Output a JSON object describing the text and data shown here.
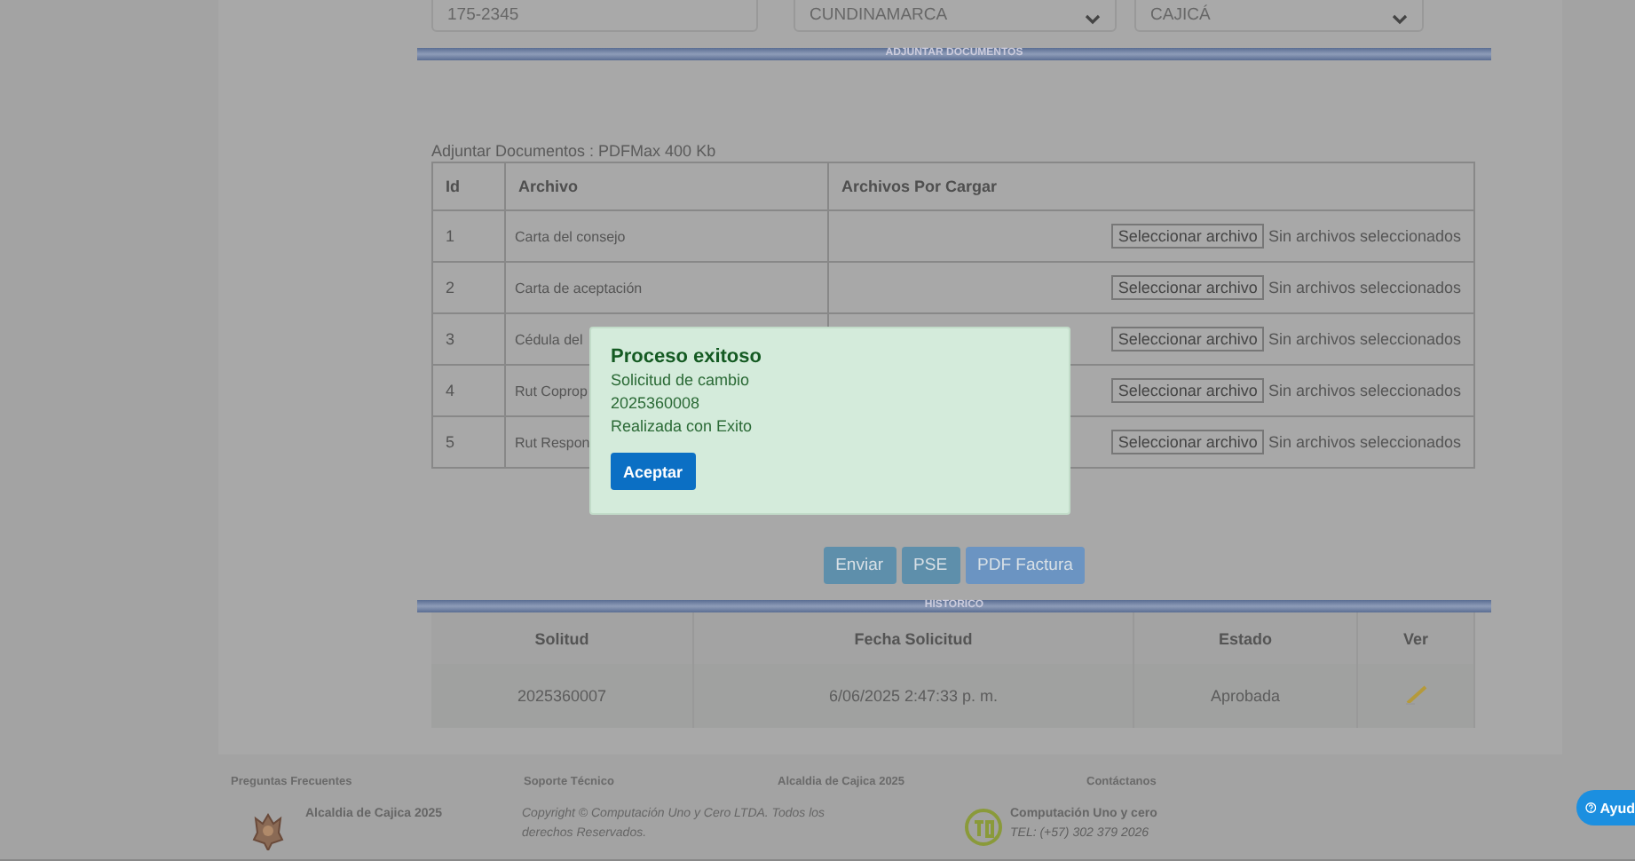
{
  "address_fields": [
    {
      "kind": "text",
      "value": "175-2345"
    },
    {
      "kind": "select",
      "value": "CUNDINAMARCA"
    },
    {
      "kind": "select",
      "value": "CAJICÁ"
    }
  ],
  "attach_section": {
    "title": "ADJUNTAR DOCUMENTOS",
    "note": "Adjuntar Documentos : PDFMax 400 Kb",
    "columns": [
      "Id",
      "Archivo",
      "Archivos Por Cargar"
    ],
    "rows": [
      {
        "id": "1",
        "file": "Carta del consejo",
        "button": "Seleccionar archivo",
        "status": "Sin archivos seleccionados"
      },
      {
        "id": "2",
        "file": "Carta de aceptación",
        "button": "Seleccionar archivo",
        "status": "Sin archivos seleccionados"
      },
      {
        "id": "3",
        "file": "Cédula del",
        "button": "Seleccionar archivo",
        "status": "Sin archivos seleccionados"
      },
      {
        "id": "4",
        "file": "Rut Coprop",
        "button": "Seleccionar archivo",
        "status": "Sin archivos seleccionados"
      },
      {
        "id": "5",
        "file": "Rut Respon",
        "button": "Seleccionar archivo",
        "status": "Sin archivos seleccionados"
      }
    ]
  },
  "actions": [
    {
      "label": "Enviar",
      "kind": "primary"
    },
    {
      "label": "PSE",
      "kind": "primary"
    },
    {
      "label": "PDF Factura",
      "kind": "info"
    }
  ],
  "history": {
    "title": "HISTORICO",
    "columns": [
      "Solitud",
      "Fecha Solicitud",
      "Estado",
      "Ver"
    ],
    "rows": [
      {
        "request": "2025360007",
        "date": "6/06/2025 2:47:33 p. m.",
        "status": "Aprobada"
      }
    ]
  },
  "footer": {
    "headings": [
      "Preguntas Frecuentes",
      "Soporte Técnico",
      "Alcaldia de Cajica 2025",
      "Contáctanos"
    ],
    "brand": "Alcaldia de Cajica 2025",
    "copyright": "Copyright © Computación Uno y Cero LTDA. Todos los derechos Reservados.",
    "company": "Computación Uno y cero",
    "phone": "TEL: (+57) 302 379 2026"
  },
  "help_button": "Ayud",
  "dialog": {
    "title": "Proceso exitoso",
    "lines": [
      "Solicitud de cambio",
      "2025360008",
      "Realizada con Exito"
    ],
    "button": "Aceptar"
  }
}
